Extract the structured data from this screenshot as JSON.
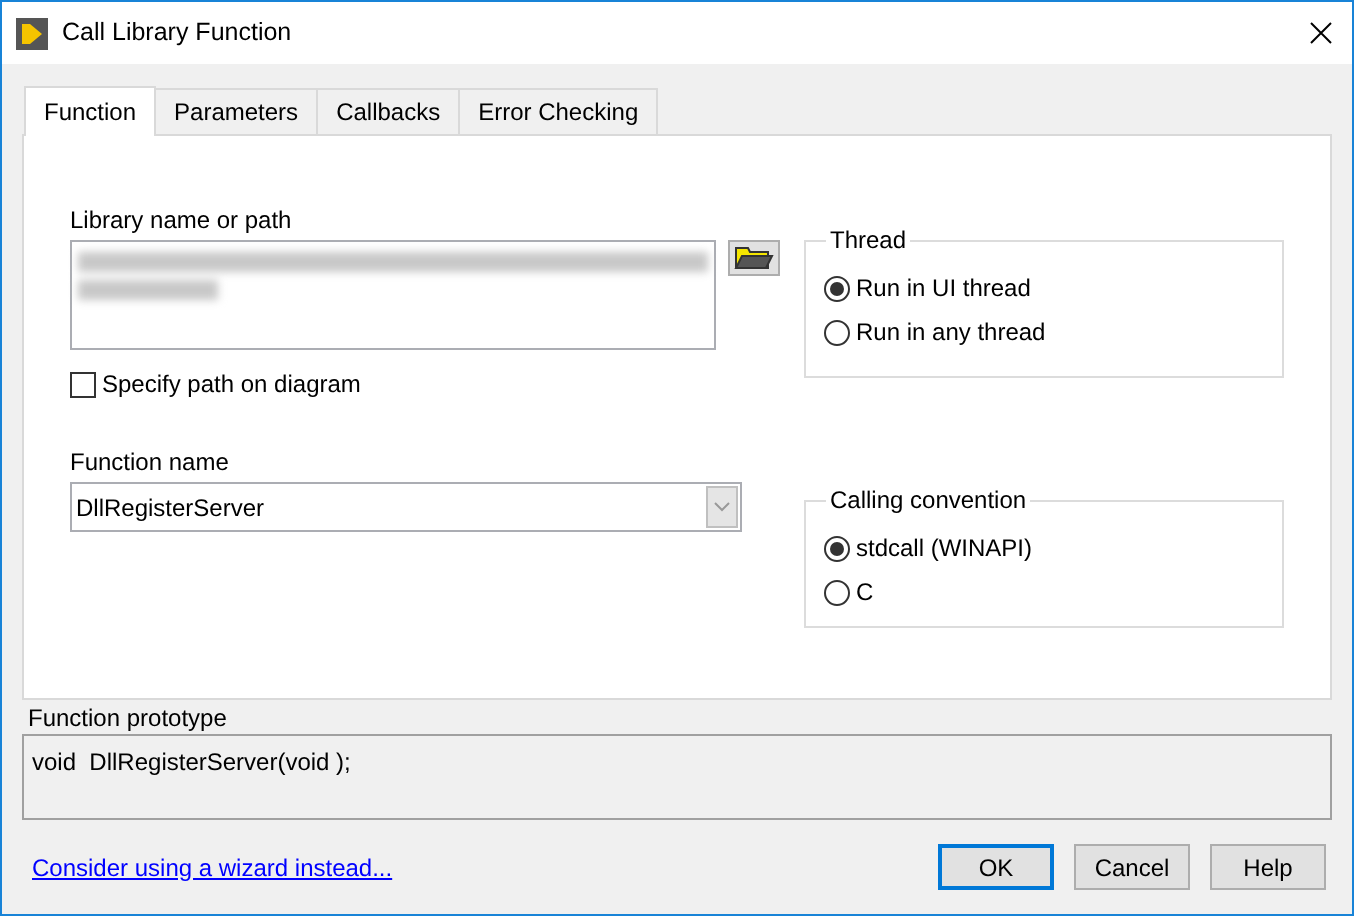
{
  "window": {
    "title": "Call Library Function"
  },
  "tabs": [
    {
      "label": "Function",
      "selected": true
    },
    {
      "label": "Parameters",
      "selected": false
    },
    {
      "label": "Callbacks",
      "selected": false
    },
    {
      "label": "Error Checking",
      "selected": false
    }
  ],
  "library": {
    "label": "Library name or path"
  },
  "specify_path": {
    "label": "Specify path on diagram",
    "checked": false
  },
  "function_name": {
    "label": "Function name",
    "value": "DllRegisterServer"
  },
  "thread": {
    "title": "Thread",
    "options": [
      {
        "label": "Run in UI thread",
        "selected": true
      },
      {
        "label": "Run in any thread",
        "selected": false
      }
    ]
  },
  "calling_convention": {
    "title": "Calling convention",
    "options": [
      {
        "label": "stdcall (WINAPI)",
        "selected": true
      },
      {
        "label": "C",
        "selected": false
      }
    ]
  },
  "prototype": {
    "label": "Function prototype",
    "value": "void  DllRegisterServer(void );"
  },
  "wizard_link": "Consider using a wizard instead...",
  "buttons": [
    {
      "label": "OK",
      "default": true
    },
    {
      "label": "Cancel",
      "default": false
    },
    {
      "label": "Help",
      "default": false
    }
  ]
}
